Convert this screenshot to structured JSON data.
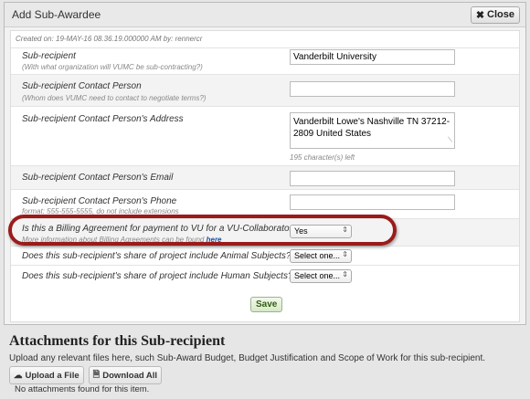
{
  "dialog": {
    "title": "Add Sub-Awardee",
    "close_label": "Close",
    "created_text": "Created on: 19-MAY-16 08.36.19.000000 AM  by: rennercr"
  },
  "fields": {
    "subrecipient": {
      "label": "Sub-recipient",
      "hint": "(With what organization will VUMC be sub-contracting?)",
      "value": "Vanderbilt University"
    },
    "contact_person": {
      "label": "Sub-recipient Contact Person",
      "hint": "(Whom does VUMC need to contact to negotiate terms?)",
      "value": ""
    },
    "contact_address": {
      "label": "Sub-recipient Contact Person's Address",
      "value": "Vanderbilt Lowe's Nashville TN 37212-2809 United States",
      "counter": "195 character(s) left"
    },
    "contact_email": {
      "label": "Sub-recipient Contact Person's Email",
      "value": ""
    },
    "contact_phone": {
      "label": "Sub-recipient Contact Person's Phone",
      "hint": "format: 555-555-5555, do not include extensions",
      "value": ""
    },
    "billing_agreement": {
      "label": "Is this a Billing Agreement for payment to VU for a VU-Collaborator?",
      "hint": "More information about Billing Agreements can be found",
      "link": "here",
      "value": "Yes"
    },
    "animal_subjects": {
      "label": "Does this sub-recipient's share of project include Animal Subjects?",
      "value": "Select one..."
    },
    "human_subjects": {
      "label": "Does this sub-recipient's share of project include Human Subjects?",
      "value": "Select one..."
    }
  },
  "save_label": "Save",
  "attachments": {
    "title": "Attachments for this Sub-recipient",
    "description": "Upload any relevant files here, such Sub-Award Budget, Budget Justification and Scope of Work for this sub-recipient.",
    "upload_label": "Upload a File",
    "download_label": "Download All",
    "empty_text": "No attachments found for this item."
  },
  "colors": {
    "highlight": "#9b1b1b",
    "save": "#2d5f10",
    "link": "#1a55a8"
  },
  "icons": [
    "close-icon",
    "upload-icon",
    "download-icon",
    "select-arrow-icon",
    "resize-handle-icon"
  ]
}
